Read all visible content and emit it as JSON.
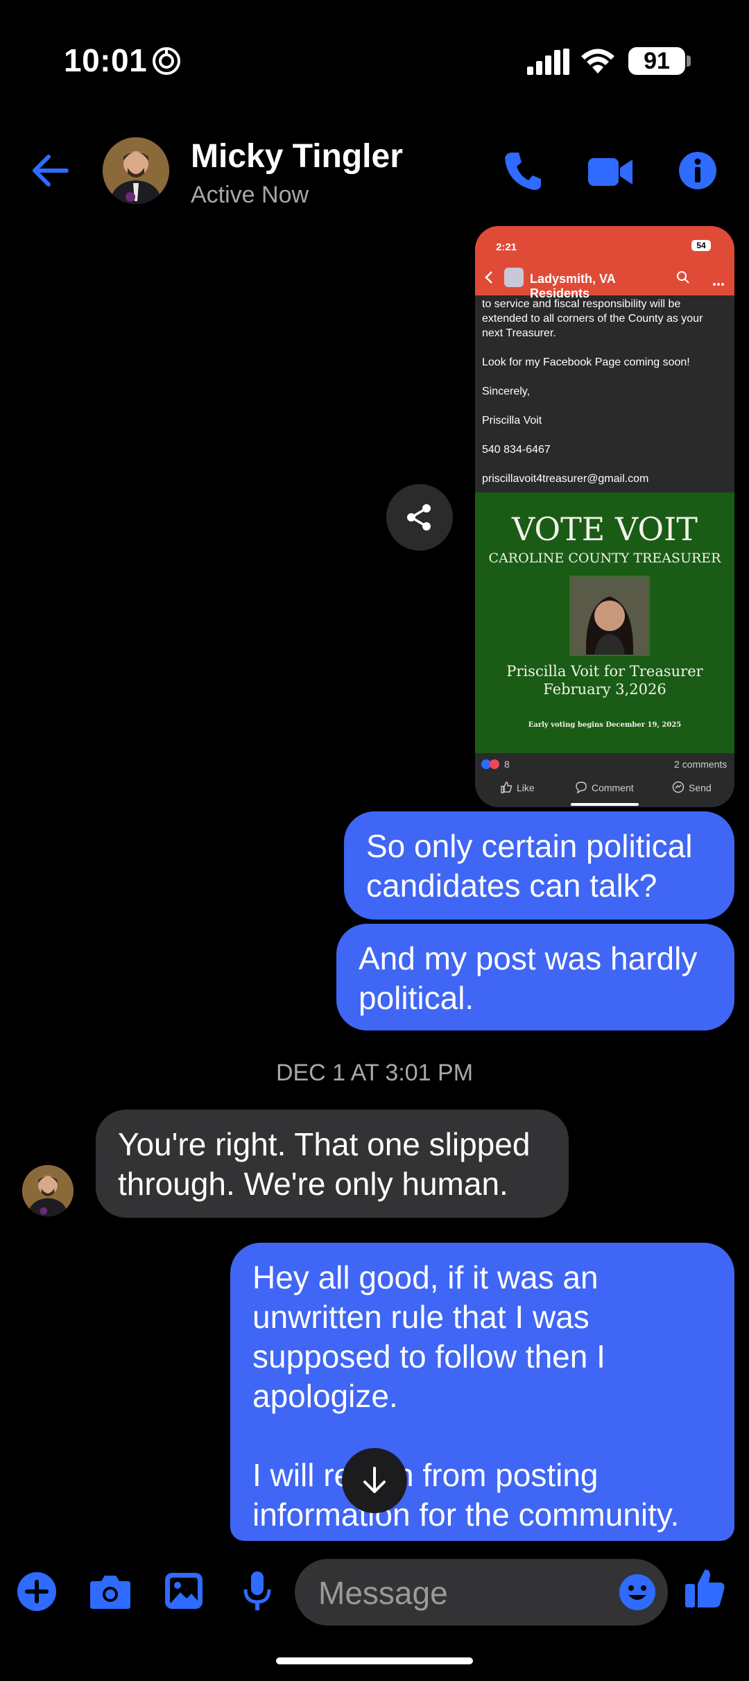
{
  "status_bar": {
    "time": "10:01",
    "battery": "91"
  },
  "header": {
    "name": "Micky Tingler",
    "status": "Active Now"
  },
  "shared_screenshot": {
    "time": "2:21",
    "battery": "54",
    "group_title": "Ladysmith, VA Residents",
    "post_lines": [
      "to service and fiscal responsibility will be",
      "extended to all corners of the County as your",
      "next Treasurer."
    ],
    "facebook_line": "Look for my Facebook Page coming soon!",
    "sincerely": "Sincerely,",
    "signature": "Priscilla Voit",
    "phone": "540 834-6467",
    "email": "priscillavoit4treasurer@gmail.com",
    "poster": {
      "title": "VOTE VOIT",
      "subtitle": "CAROLINE COUNTY TREASURER",
      "line1": "Priscilla Voit for Treasurer",
      "line2": "February 3,2026",
      "early": "Early voting begins December 19, 2025"
    },
    "reactions_count": "8",
    "comments_count": "2 comments",
    "like_label": "Like",
    "comment_label": "Comment",
    "send_label": "Send"
  },
  "messages": {
    "m1": "So only certain political candidates can talk?",
    "m2": "And my post was hardly political.",
    "timestamp": "DEC 1 AT 3:01 PM",
    "m3": "You're right. That one slipped through. We're only human.",
    "m4a": "Hey all good, if it was an unwritten rule that I was supposed to follow then I apologize.",
    "m4b": "I will refrain from posting information for the community."
  },
  "composer": {
    "placeholder": "Message"
  },
  "colors": {
    "accent": "#3f66f5",
    "icon_blue": "#2f6bff",
    "incoming": "#333335",
    "facebook_red": "#e04b38",
    "poster_green": "#1a5c16"
  }
}
